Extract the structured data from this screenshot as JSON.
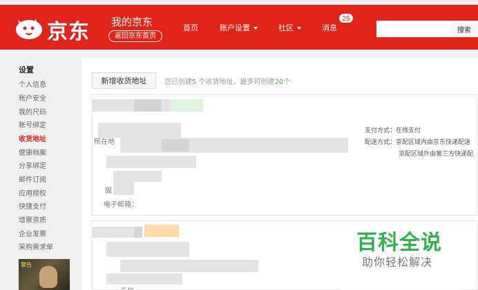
{
  "header": {
    "logo_text": "京东",
    "site_title": "我的京东",
    "back_home": "返回京东首页",
    "nav": {
      "home": "首页",
      "account": "账户设置",
      "community": "社区",
      "messages": "消息"
    },
    "message_count": "25",
    "search_button": "搜索",
    "search_value": "",
    "accent_color": "#e2231a"
  },
  "sidebar": {
    "heading": "设置",
    "items": [
      {
        "label": "个人信息"
      },
      {
        "label": "账户安全"
      },
      {
        "label": "我的尺码"
      },
      {
        "label": "账号绑定"
      },
      {
        "label": "收货地址",
        "active": true
      },
      {
        "label": "健康档案"
      },
      {
        "label": "分享绑定"
      },
      {
        "label": "邮件订阅"
      },
      {
        "label": "应用授权"
      },
      {
        "label": "快捷支付"
      },
      {
        "label": "增票资质"
      },
      {
        "label": "企业发票"
      },
      {
        "label": "采购需求单"
      }
    ],
    "promo_tag": "警告"
  },
  "main": {
    "add_button": "新增收货地址",
    "created_prefix": "您已创建",
    "created_count": "5",
    "created_middle": " 个收货地址，最多可创建",
    "max_count": "20",
    "created_suffix": "个",
    "card1": {
      "region_label": "所在地",
      "phone_label": "固",
      "email_label": "电子邮箱：",
      "payment": "支付方式：在线支付",
      "delivery_line1": "配送方式：京配区域内由京东快递配送",
      "delivery_line2": "京配区域外由第三方快递配"
    },
    "card2": {
      "phone_label": "手机"
    }
  },
  "watermark": {
    "title": "百科全说",
    "subtitle": "助你轻松解决"
  }
}
